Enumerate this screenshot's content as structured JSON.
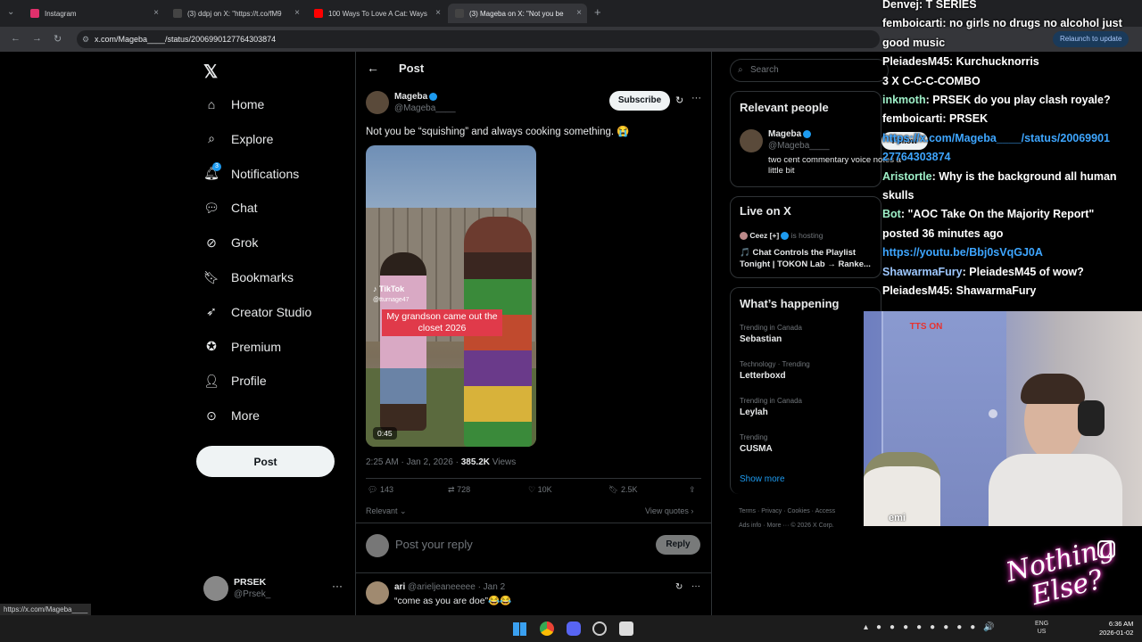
{
  "browser": {
    "tabs": [
      {
        "title": "Instagram",
        "color": "#e1306c"
      },
      {
        "title": "(3) ddpj on X: \"https://t.co/fM9",
        "color": "#444"
      },
      {
        "title": "100 Ways To Love A Cat: Ways",
        "color": "#ff0000"
      },
      {
        "title": "(3) Mageba on X: \"Not you be",
        "color": "#444"
      }
    ],
    "url": "x.com/Mageba____/status/2006990127764303874",
    "relaunch": "Relaunch to update",
    "status_url": "https://x.com/Mageba____"
  },
  "nav": {
    "items": [
      {
        "label": "Home",
        "icon": "home-icon"
      },
      {
        "label": "Explore",
        "icon": "search-icon"
      },
      {
        "label": "Notifications",
        "icon": "bell-icon",
        "badge": "3"
      },
      {
        "label": "Chat",
        "icon": "chat-icon"
      },
      {
        "label": "Grok",
        "icon": "grok-icon"
      },
      {
        "label": "Bookmarks",
        "icon": "bookmark-icon"
      },
      {
        "label": "Creator Studio",
        "icon": "rocket-icon"
      },
      {
        "label": "Premium",
        "icon": "premium-icon"
      },
      {
        "label": "Profile",
        "icon": "person-icon"
      },
      {
        "label": "More",
        "icon": "more-circle-icon"
      }
    ],
    "post_label": "Post",
    "account_name": "PRSEK",
    "account_handle": "@Prsek_"
  },
  "post": {
    "header": "Post",
    "author": "Mageba",
    "handle": "@Mageba____",
    "subscribe": "Subscribe",
    "text": "Not you be “squishing” and always cooking something. 😭",
    "video": {
      "brand": "TikTok",
      "user": "@tturnage47",
      "caption": "My grandson came out the closet 2026",
      "duration": "0:45"
    },
    "time": "2:25 AM · Jan 2, 2026 · ",
    "views": "385.2K",
    "views_label": " Views",
    "replies": "143",
    "reposts": "728",
    "likes": "10K",
    "bookmarks": "2.5K",
    "sort": "Relevant",
    "view_quotes": "View quotes",
    "reply_placeholder": "Post your reply",
    "reply_button": "Reply"
  },
  "reply": {
    "name": "ari",
    "handle": "@arieljeaneeeee",
    "date": "· Jan 2",
    "text": "“come as you are doe”😂😂"
  },
  "right": {
    "search_placeholder": "Search",
    "relevant_title": "Relevant people",
    "relevant_name": "Mageba",
    "relevant_handle": "@Mageba____",
    "relevant_bio": "two cent commentary voice notes a little bit",
    "follow": "Follow",
    "live_title": "Live on X",
    "live_host": "Ceez [+]",
    "live_hosting": "is hosting",
    "live_text": "🎵 Chat Controls the Playlist Tonight | TOKON Lab → Ranke...",
    "happening_title": "What’s happening",
    "trends": [
      {
        "meta": "Trending in Canada",
        "name": "Sebastian"
      },
      {
        "meta": "Technology · Trending",
        "name": "Letterboxd"
      },
      {
        "meta": "Trending in Canada",
        "name": "Leylah"
      },
      {
        "meta": "Trending",
        "name": "CUSMA"
      }
    ],
    "show_more": "Show more",
    "footer1": "Terms · Privacy · Cookies · Access",
    "footer2": "Ads info · More ··· © 2026 X Corp."
  },
  "chat": [
    {
      "name": "Denvej",
      "text": ": T SERIES",
      "color": "#ffffff"
    },
    {
      "name": "femboicarti",
      "text": ": no girls no drugs no alcohol just",
      "color": "#ffffff"
    },
    {
      "name": "",
      "text": "good music",
      "color": "#ffffff"
    },
    {
      "name": "PleiadesM45",
      "text": ": Kurchucknorris",
      "color": "#ffffff"
    },
    {
      "name": "",
      "text": "3 X C-C-C-COMBO",
      "color": "#ffffff"
    },
    {
      "name": "inkmoth",
      "text": ": PRSEK do you play clash royale?",
      "color": "#9ef0c8"
    },
    {
      "name": "femboicarti",
      "text": ": PRSEK",
      "color": "#ffffff"
    },
    {
      "name": "",
      "text": "https://x.com/Mageba____/status/20069901",
      "color": "#3ea6ff"
    },
    {
      "name": "",
      "text": "27764303874",
      "color": "#3ea6ff"
    },
    {
      "name": "Aristortle",
      "text": ": Why is the background all human",
      "color": "#9ef0c8"
    },
    {
      "name": "",
      "text": "skulls",
      "color": "#ffffff"
    },
    {
      "name": "Bot",
      "text": ": \"AOC Take On the Majority Report\"",
      "color": "#9ef0c8"
    },
    {
      "name": "",
      "text": "posted 36 minutes ago",
      "color": "#ffffff"
    },
    {
      "name": "",
      "text": "https://youtu.be/Bbj0sVqGJ0A",
      "color": "#3ea6ff"
    },
    {
      "name": "ShawarmaFury",
      "text": ": PleiadesM45 of wow?",
      "color": "#9ec8ff"
    },
    {
      "name": "PleiadesM45",
      "text": ": ShawarmaFury",
      "color": "#ffffff"
    }
  ],
  "overlay": {
    "tts": "TTS ON",
    "emi": "emi",
    "brand": "Nothing Else?"
  },
  "taskbar": {
    "time": "6:36 AM",
    "date": "2026-01-02",
    "lang": "ENG",
    "region": "US"
  }
}
